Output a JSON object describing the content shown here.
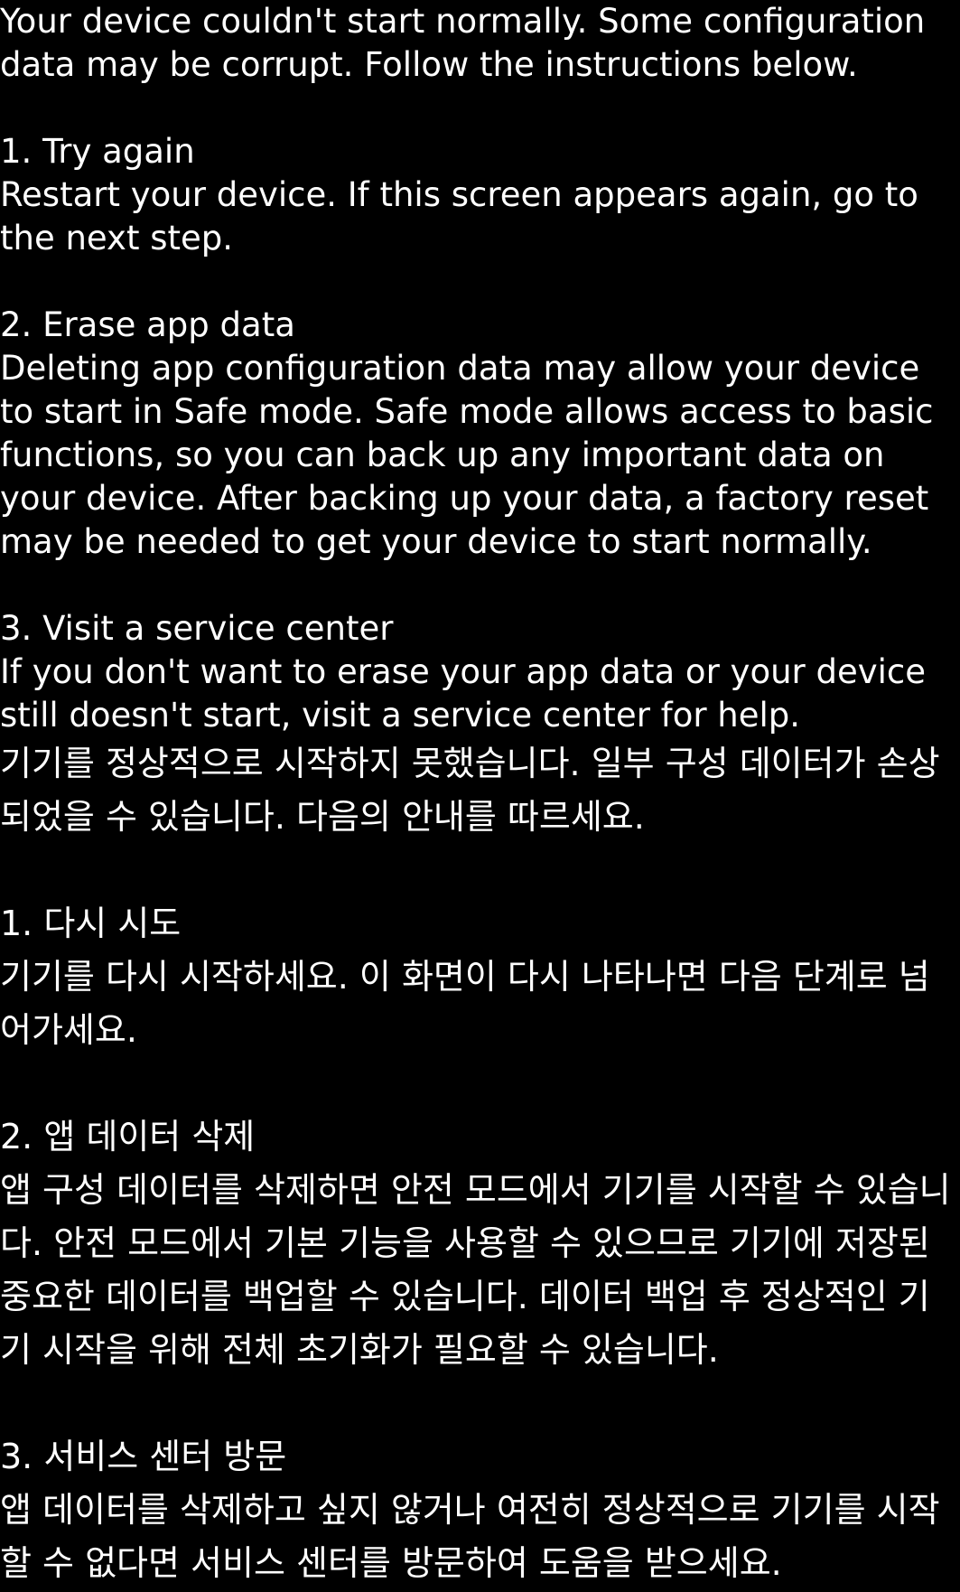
{
  "colors": {
    "background": "#000000",
    "text": "#ffffff"
  },
  "english": {
    "intro": "Your device couldn't start normally. Some configuration data may be corrupt. Follow the instructions below.",
    "steps": [
      {
        "title": "1. Try again",
        "body": "Restart your device. If this screen appears again, go to the next step."
      },
      {
        "title": "2. Erase app data",
        "body": "Deleting app configuration data may allow your device to start in Safe mode. Safe mode allows access to basic functions, so you can back up any important data on your device. After backing up your data, a factory reset may be needed to get your device to start normally."
      },
      {
        "title": "3. Visit a service center",
        "body": "If you don't want to erase your app data or your device still doesn't start, visit a service center for help."
      }
    ]
  },
  "korean": {
    "intro": "기기를 정상적으로 시작하지 못했습니다. 일부 구성 데이터가 손상되었을 수 있습니다. 다음의 안내를 따르세요.",
    "steps": [
      {
        "title": "1. 다시 시도",
        "body": "기기를 다시 시작하세요. 이 화면이 다시 나타나면 다음 단계로 넘어가세요."
      },
      {
        "title": "2. 앱 데이터 삭제",
        "body": "앱 구성 데이터를 삭제하면 안전 모드에서 기기를 시작할 수 있습니다. 안전 모드에서 기본 기능을 사용할 수 있으므로 기기에 저장된 중요한 데이터를 백업할 수 있습니다. 데이터 백업 후 정상적인 기기 시작을 위해 전체 초기화가 필요할 수 있습니다."
      },
      {
        "title": "3. 서비스 센터 방문",
        "body": "앱 데이터를 삭제하고 싶지 않거나 여전히 정상적으로 기기를 시작할 수 없다면 서비스 센터를 방문하여 도움을 받으세요."
      }
    ]
  }
}
